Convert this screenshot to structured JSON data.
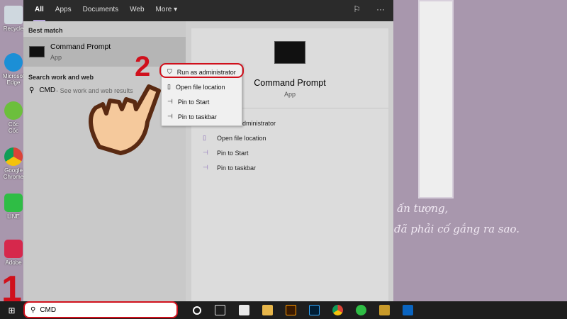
{
  "desktop": {
    "icons": [
      "Recycle",
      "Microsoft Edge",
      "Cốc Cốc",
      "Google Chrome",
      "LINE",
      "Adobe"
    ],
    "wallpaper_text": [
      "ấn tượng,",
      "đã phải cố gắng ra sao."
    ]
  },
  "menu": {
    "tabs": [
      "All",
      "Apps",
      "Documents",
      "Web",
      "More ▾"
    ],
    "best_match_label": "Best match",
    "best_match": {
      "title": "Command Prompt",
      "subtitle": "App"
    },
    "search_web_label": "Search work and web",
    "web_result": {
      "query": "CMD",
      "suffix": " - See work and web results"
    },
    "context_menu": [
      "Run as administrator",
      "Open file location",
      "Pin to Start",
      "Pin to taskbar"
    ],
    "detail": {
      "title": "Command Prompt",
      "subtitle": "App",
      "actions": [
        "Run as administrator",
        "Open file location",
        "Pin to Start",
        "Pin to taskbar"
      ]
    }
  },
  "taskbar": {
    "search_value": "CMD"
  },
  "annotations": {
    "step1": "1",
    "step2": "2"
  },
  "colors": {
    "highlight": "#d0101c",
    "accent": "#8a6cb8"
  }
}
